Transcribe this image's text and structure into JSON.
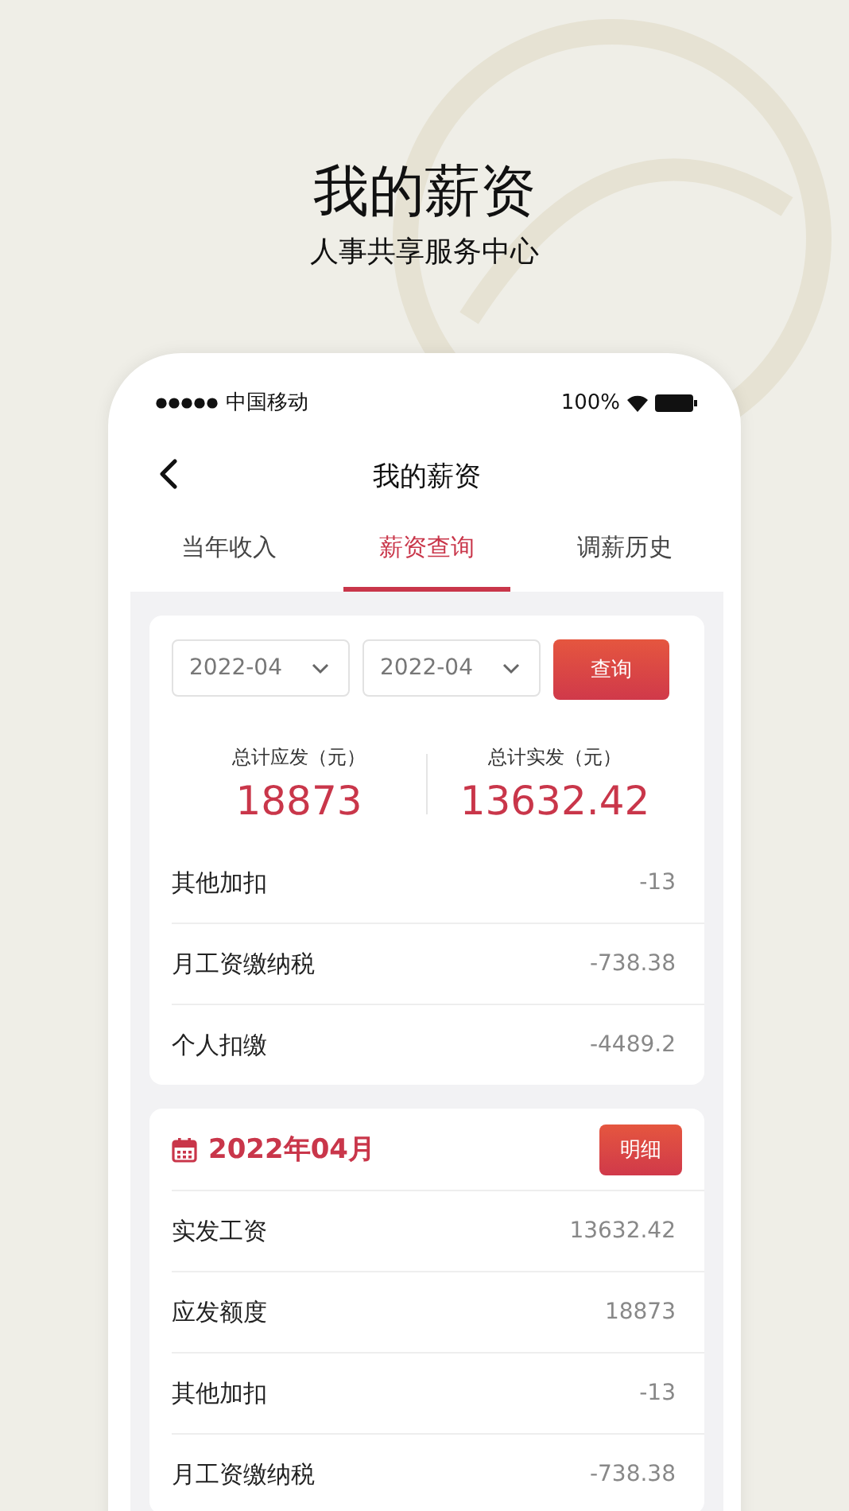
{
  "header": {
    "title": "我的薪资",
    "subtitle": "人事共享服务中心"
  },
  "status_bar": {
    "carrier": "中国移动",
    "battery": "100%"
  },
  "nav": {
    "title": "我的薪资"
  },
  "tabs": [
    {
      "label": "当年收入",
      "selected": false
    },
    {
      "label": "薪资查询",
      "selected": true
    },
    {
      "label": "调薪历史",
      "selected": false
    }
  ],
  "query": {
    "start": "2022-04",
    "end": "2022-04",
    "button": "查询"
  },
  "summary": [
    {
      "label": "总计应发（元）",
      "value": "18873"
    },
    {
      "label": "总计实发（元）",
      "value": "13632.42"
    }
  ],
  "summary_rows": [
    {
      "label": "其他加扣",
      "value": "-13"
    },
    {
      "label": "月工资缴纳税",
      "value": "-738.38"
    },
    {
      "label": "个人扣缴",
      "value": "-4489.2"
    }
  ],
  "month": {
    "title": "2022年04月",
    "button": "明细",
    "rows": [
      {
        "label": "实发工资",
        "value": "13632.42"
      },
      {
        "label": "应发额度",
        "value": "18873"
      },
      {
        "label": "其他加扣",
        "value": "-13"
      },
      {
        "label": "月工资缴纳税",
        "value": "-738.38"
      }
    ]
  }
}
